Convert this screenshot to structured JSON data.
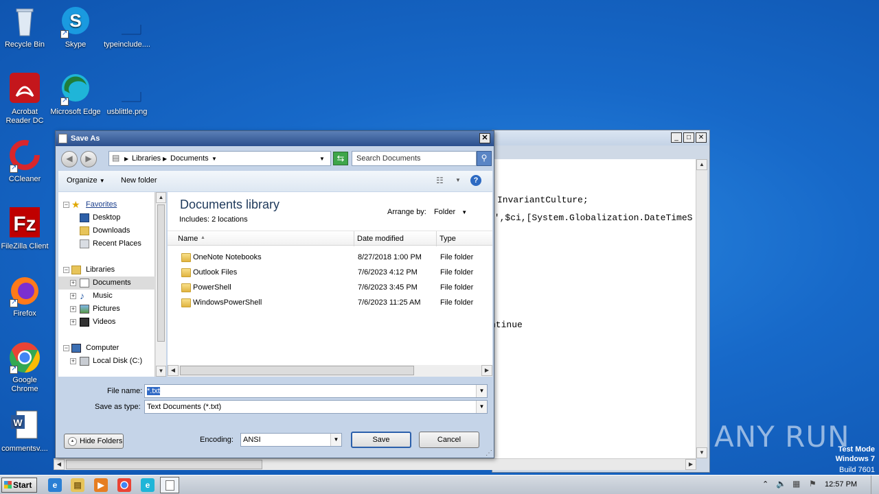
{
  "desktop": {
    "icons": [
      {
        "label": "Recycle Bin",
        "icon": "recycle-bin-icon"
      },
      {
        "label": "Skype",
        "icon": "skype-icon"
      },
      {
        "label": "typeinclude....",
        "icon": "file-icon"
      },
      {
        "label": "Acrobat Reader DC",
        "icon": "acrobat-icon"
      },
      {
        "label": "Microsoft Edge",
        "icon": "edge-icon"
      },
      {
        "label": "usblittle.png",
        "icon": "image-file-icon"
      },
      {
        "label": "CCleaner",
        "icon": "ccleaner-icon"
      },
      {
        "label": "FileZilla Client",
        "icon": "filezilla-icon"
      },
      {
        "label": "Firefox",
        "icon": "firefox-icon"
      },
      {
        "label": "Google Chrome",
        "icon": "chrome-icon"
      },
      {
        "label": "commentsv....",
        "icon": "word-doc-icon"
      }
    ],
    "watermark": "ANY RUN",
    "test_mode": [
      "Test Mode",
      "Windows 7",
      "Build 7601"
    ]
  },
  "notepad": {
    "controls": [
      "_",
      "□",
      "✕"
    ],
    "lines": [
      "InvariantCulture;",
      "k',$ci,[System.Globalization.DateTimeS",
      "ntinue"
    ]
  },
  "dialog": {
    "title": "Save As",
    "close": "✕",
    "breadcrumb": [
      "Libraries",
      "Documents"
    ],
    "search_placeholder": "Search Documents",
    "organize": "Organize",
    "new_folder": "New folder",
    "help": "?",
    "nav": {
      "favorites": "Favorites",
      "desktop": "Desktop",
      "downloads": "Downloads",
      "recent": "Recent Places",
      "libraries": "Libraries",
      "documents": "Documents",
      "music": "Music",
      "pictures": "Pictures",
      "videos": "Videos",
      "computer": "Computer",
      "local_disk": "Local Disk (C:)"
    },
    "library_title": "Documents library",
    "library_sub": "Includes:  2 locations",
    "arrange_label": "Arrange by:",
    "arrange_value": "Folder",
    "columns": {
      "name": "Name",
      "date": "Date modified",
      "type": "Type"
    },
    "files": [
      {
        "name": "OneNote Notebooks",
        "date": "8/27/2018 1:00 PM",
        "type": "File folder"
      },
      {
        "name": "Outlook Files",
        "date": "7/6/2023 4:12 PM",
        "type": "File folder"
      },
      {
        "name": "PowerShell",
        "date": "7/6/2023 3:45 PM",
        "type": "File folder"
      },
      {
        "name": "WindowsPowerShell",
        "date": "7/6/2023 11:25 AM",
        "type": "File folder"
      }
    ],
    "file_name_label": "File name:",
    "file_name_value": "*.txt",
    "save_type_label": "Save as type:",
    "save_type_value": "Text Documents (*.txt)",
    "hide_folders": "Hide Folders",
    "encoding_label": "Encoding:",
    "encoding_value": "ANSI",
    "save": "Save",
    "cancel": "Cancel"
  },
  "taskbar": {
    "start": "Start",
    "clock": "12:57 PM"
  }
}
